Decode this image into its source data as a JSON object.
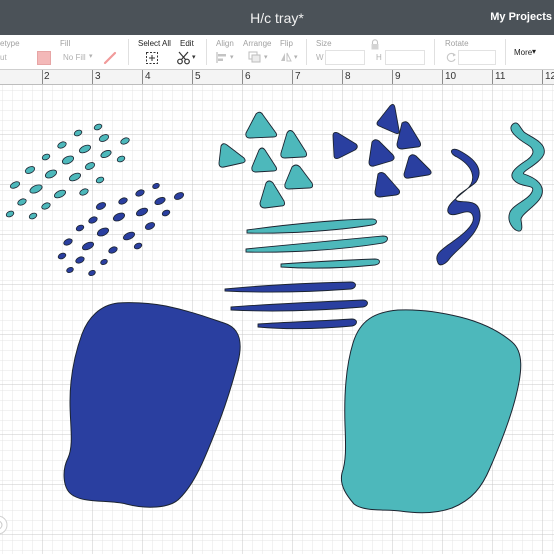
{
  "window": {
    "title": "H/c tray*",
    "projects_label": "My Projects"
  },
  "toolbar": {
    "linetype_label": "etype",
    "linetype_value": "ut",
    "fill_label": "Fill",
    "fill_value": "No Fill",
    "select_all_label": "Select All",
    "edit_label": "Edit",
    "align_label": "Align",
    "arrange_label": "Arrange",
    "flip_label": "Flip",
    "size_label": "Size",
    "size_w_label": "W",
    "size_h_label": "H",
    "rotate_label": "Rotate",
    "more_label": "More",
    "fill_swatch_color": "#f3b8b8"
  },
  "ruler": {
    "numbers": [
      "2",
      "3",
      "4",
      "5",
      "6",
      "7",
      "8",
      "9",
      "10",
      "11",
      "12"
    ]
  },
  "colors": {
    "teal": "#4db8bb",
    "blue": "#2a3fa0",
    "outline": "#1c2430",
    "grid_minor": "#e3e3e3",
    "grid_major": "#c9c9c9",
    "titlebar": "#4b5258"
  }
}
